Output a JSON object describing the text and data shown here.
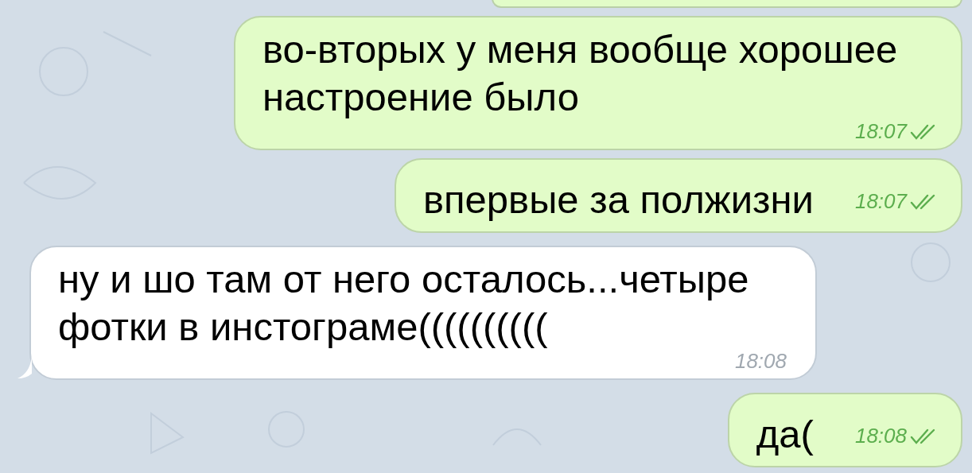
{
  "messages": [
    {
      "kind": "cut",
      "outgoing": true
    },
    {
      "kind": "text",
      "outgoing": true,
      "text": "во-вторых у меня вообще хорошее настроение было",
      "time": "18:07",
      "read": true
    },
    {
      "kind": "text",
      "outgoing": true,
      "text": "впервые за полжизни",
      "time": "18:07",
      "read": true
    },
    {
      "kind": "text",
      "outgoing": false,
      "text": "ну и шо там от него осталось...четыре фотки в инстограме((((((((((",
      "time": "18:08"
    },
    {
      "kind": "text",
      "outgoing": true,
      "text": "да(",
      "time": "18:08",
      "read": true
    }
  ]
}
